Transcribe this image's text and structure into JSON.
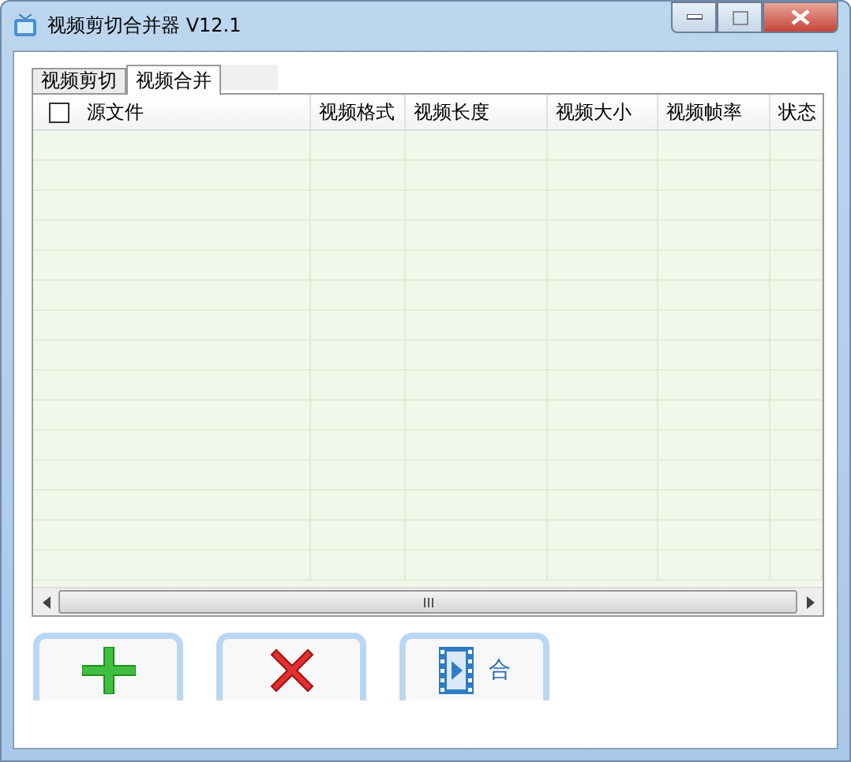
{
  "window": {
    "title": "视频剪切合并器 V12.1"
  },
  "tabs": [
    {
      "label": "视频剪切",
      "selected": false
    },
    {
      "label": "视频合并",
      "selected": true
    }
  ],
  "table": {
    "select_all": {
      "checked": false
    },
    "columns": [
      "源文件",
      "视频格式",
      "视频长度",
      "视频大小",
      "视频帧率",
      "状态"
    ]
  },
  "buttons": [
    {
      "kind": "add"
    },
    {
      "kind": "delete"
    },
    {
      "kind": "merge",
      "label": "合"
    }
  ]
}
